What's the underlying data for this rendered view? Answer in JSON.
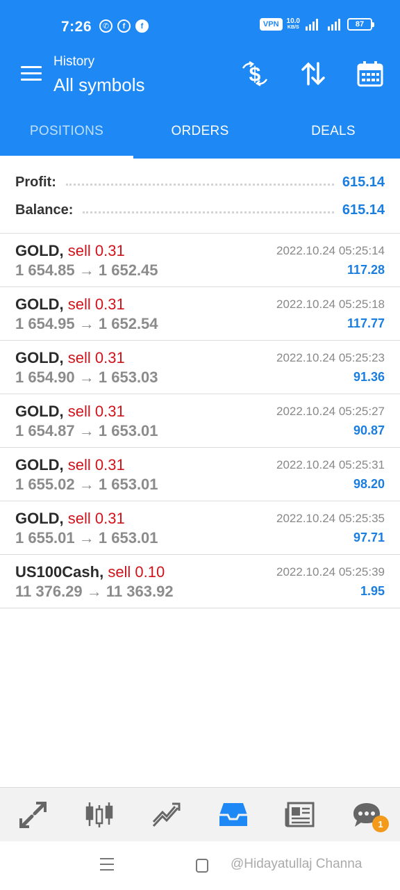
{
  "status_bar": {
    "time": "7:26",
    "vpn": "VPN",
    "net_speed": "10.0",
    "net_unit": "KB/S",
    "battery": "87"
  },
  "app_bar": {
    "subtitle": "History",
    "title": "All symbols",
    "actions": [
      "dollar-swap-icon",
      "sort-icon",
      "calendar-icon"
    ]
  },
  "tabs": [
    {
      "label": "POSITIONS",
      "active": true
    },
    {
      "label": "ORDERS",
      "active": false
    },
    {
      "label": "DEALS",
      "active": false
    }
  ],
  "summary": {
    "profit_label": "Profit:",
    "profit_value": "615.14",
    "balance_label": "Balance:",
    "balance_value": "615.14"
  },
  "positions": [
    {
      "symbol": "GOLD,",
      "side": "sell 0.31",
      "open": "1 654.85",
      "close": "1 652.45",
      "time": "2022.10.24 05:25:14",
      "profit": "117.28"
    },
    {
      "symbol": "GOLD,",
      "side": "sell 0.31",
      "open": "1 654.95",
      "close": "1 652.54",
      "time": "2022.10.24 05:25:18",
      "profit": "117.77"
    },
    {
      "symbol": "GOLD,",
      "side": "sell 0.31",
      "open": "1 654.90",
      "close": "1 653.03",
      "time": "2022.10.24 05:25:23",
      "profit": "91.36"
    },
    {
      "symbol": "GOLD,",
      "side": "sell 0.31",
      "open": "1 654.87",
      "close": "1 653.01",
      "time": "2022.10.24 05:25:27",
      "profit": "90.87"
    },
    {
      "symbol": "GOLD,",
      "side": "sell 0.31",
      "open": "1 655.02",
      "close": "1 653.01",
      "time": "2022.10.24 05:25:31",
      "profit": "98.20"
    },
    {
      "symbol": "GOLD,",
      "side": "sell 0.31",
      "open": "1 655.01",
      "close": "1 653.01",
      "time": "2022.10.24 05:25:35",
      "profit": "97.71"
    },
    {
      "symbol": "US100Cash,",
      "side": "sell 0.10",
      "open": "11 376.29",
      "close": "11 363.92",
      "time": "2022.10.24 05:25:39",
      "profit": "1.95"
    }
  ],
  "arrow": "→",
  "bottom_nav": {
    "items": [
      "quotes-icon",
      "chart-icon",
      "trade-icon",
      "history-icon",
      "news-icon",
      "chat-icon"
    ],
    "active": "history-icon",
    "chat_badge": "1"
  },
  "watermark": "@Hidayatullaj Channa",
  "colors": {
    "primary": "#1e88f5",
    "sell": "#d0121b",
    "profit": "#1a7ee0"
  }
}
